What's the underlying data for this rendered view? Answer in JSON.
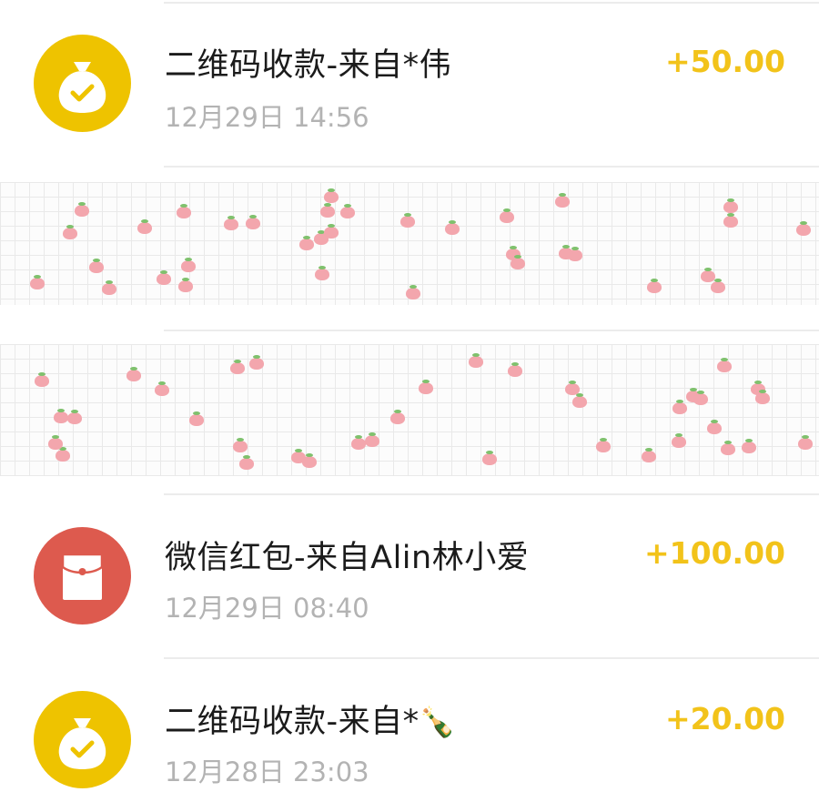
{
  "transactions": [
    {
      "title": "二维码收款-来自*伟",
      "time": "12月29日 14:56",
      "amount": "+50.00",
      "icon": "money-bag-icon",
      "icon_color": "#EEC300"
    },
    {
      "title": "微信红包-来自Alin林小爱",
      "time": "12月29日 08:40",
      "amount": "+100.00",
      "icon": "red-packet-icon",
      "icon_color": "#DD5A4E"
    },
    {
      "title": "二维码收款-来自*",
      "title_emoji": "🍾",
      "time": "12月28日 23:03",
      "amount": "+20.00",
      "icon": "money-bag-icon",
      "icon_color": "#EEC300"
    }
  ],
  "colors": {
    "amount": "#F2C31A",
    "title": "#1B1B1B",
    "time": "#B3B3B3",
    "divider": "#ECECEC",
    "sticker_strawberry": "#F3A6AD"
  }
}
